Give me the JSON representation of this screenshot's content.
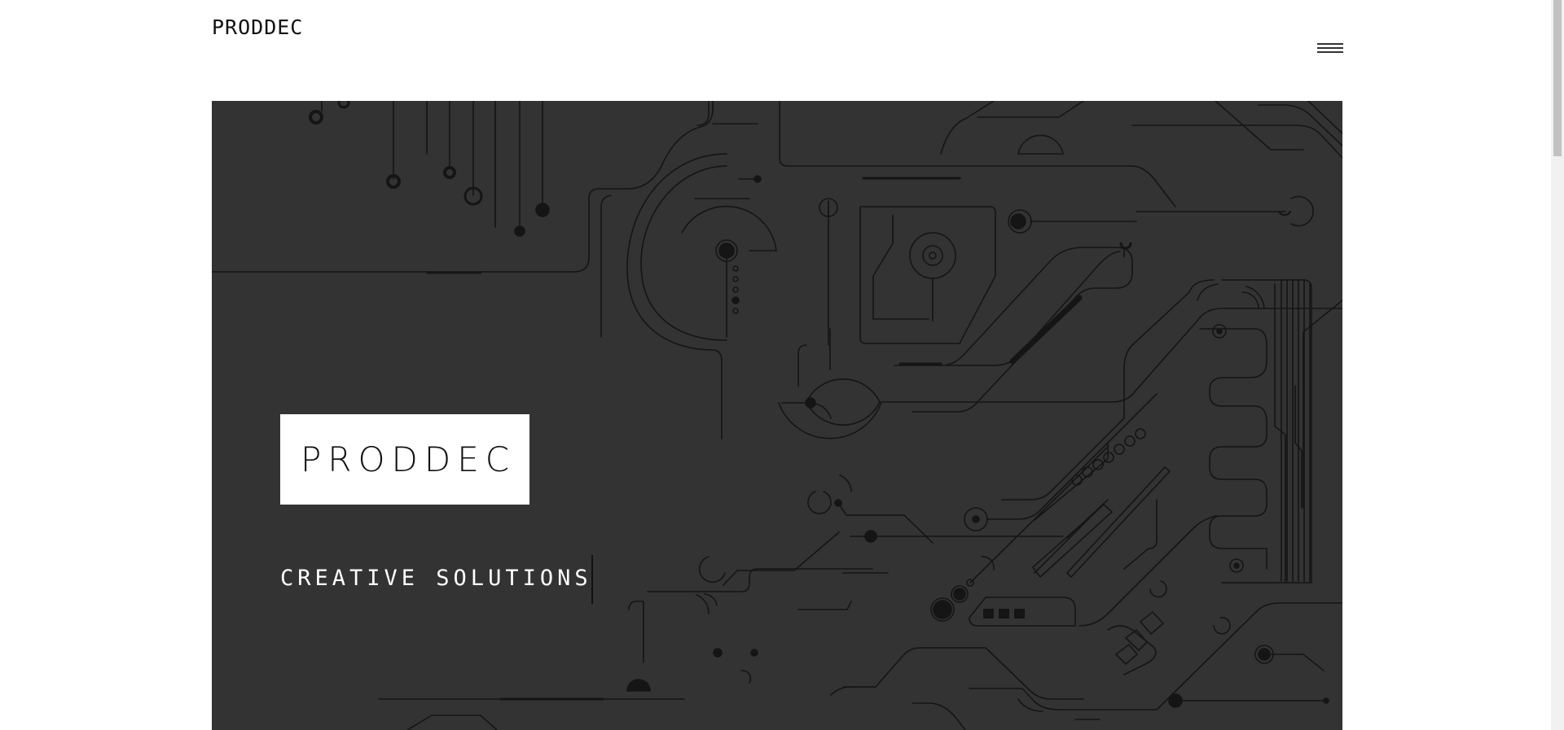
{
  "header": {
    "logo": "PRODDEC",
    "menu_icon": "hamburger-menu-icon"
  },
  "hero": {
    "brand": "PRODDEC",
    "tagline": "CREATIVE SOLUTIONS",
    "background_color": "#333333",
    "line_color": "#111111"
  },
  "scrollbar": {
    "icon": "vertical-scrollbar"
  }
}
